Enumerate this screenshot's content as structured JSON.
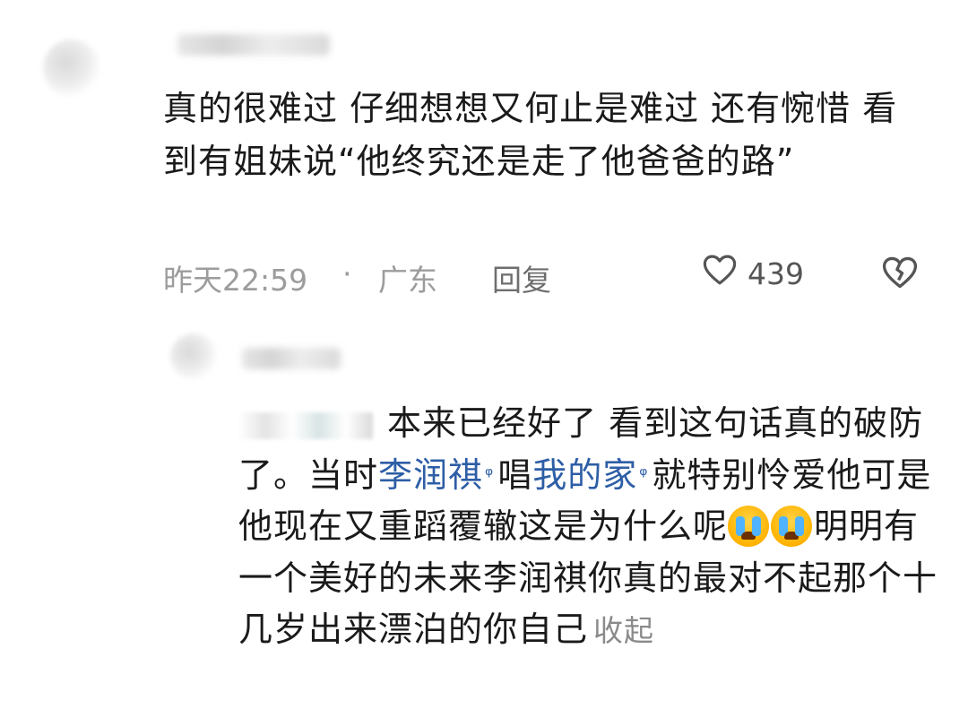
{
  "comment1": {
    "text": "真的很难过 仔细想想又何止是难过 还有惋惜 看到有姐妹说“他终究还是走了他爸爸的路”",
    "time": "昨天22:59",
    "separator": "·",
    "location": "广东",
    "reply_label": "回复",
    "likes": "439"
  },
  "comment2": {
    "part1": "本来已经好了 看到这句话真的破防了。当时",
    "link1": "李润祺",
    "part2": "唱",
    "link2": "我的家",
    "part3": "就特别怜爱他可是他现在又重蹈覆辙这是为什么呢",
    "part4": "明明有一个美好的未来李润祺你真的最对不起那个十几岁出来漂泊的你自己",
    "collapse_label": "收起"
  },
  "icons": {
    "like": "heart-outline-icon",
    "dislike": "broken-heart-icon",
    "link_search": "search-icon",
    "emoji": "crying-face-emoji"
  },
  "colors": {
    "link": "#2d5ea6",
    "meta": "#9c9c9c"
  }
}
